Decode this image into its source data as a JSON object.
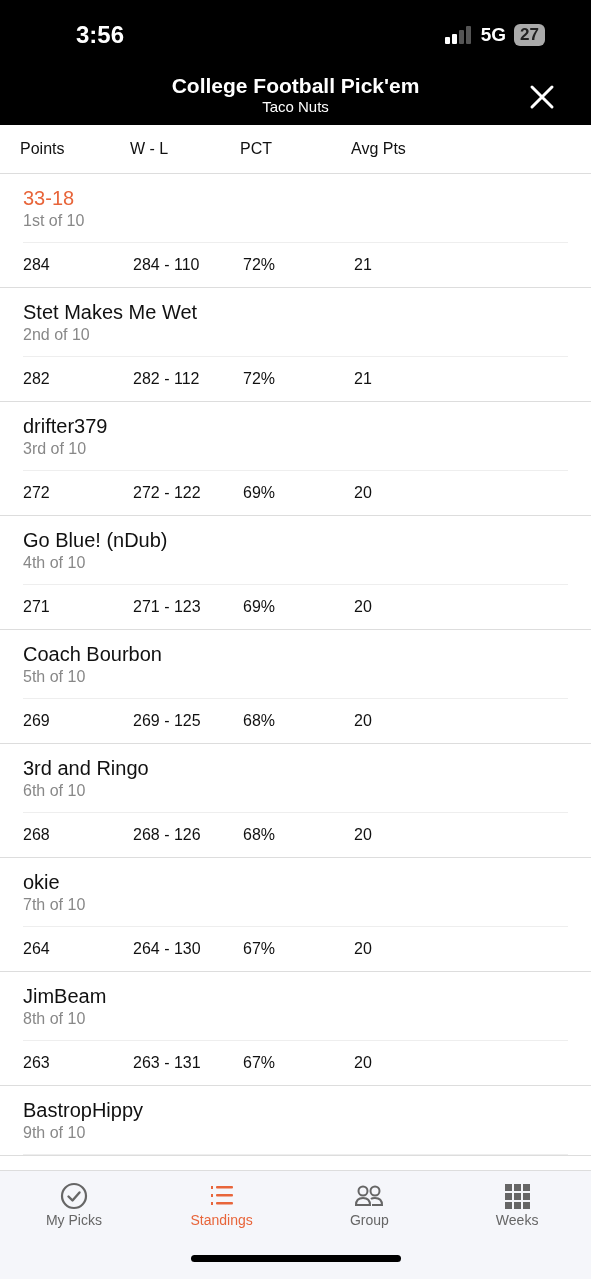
{
  "status_bar": {
    "time": "3:56",
    "network": "5G",
    "battery": "27"
  },
  "header": {
    "title": "College Football Pick'em",
    "subtitle": "Taco Nuts"
  },
  "columns": [
    "Points",
    "W - L",
    "PCT",
    "Avg Pts"
  ],
  "rows": [
    {
      "name": "33-18",
      "rank": "1st of 10",
      "highlighted": true,
      "stats": [
        "284",
        "284 - 110",
        "72%",
        "21"
      ]
    },
    {
      "name": "Stet Makes Me Wet",
      "rank": "2nd of 10",
      "highlighted": false,
      "stats": [
        "282",
        "282 - 112",
        "72%",
        "21"
      ]
    },
    {
      "name": "drifter379",
      "rank": "3rd of 10",
      "highlighted": false,
      "stats": [
        "272",
        "272 - 122",
        "69%",
        "20"
      ]
    },
    {
      "name": "Go Blue! (nDub)",
      "rank": "4th of 10",
      "highlighted": false,
      "stats": [
        "271",
        "271 - 123",
        "69%",
        "20"
      ]
    },
    {
      "name": "Coach Bourbon",
      "rank": "5th of 10",
      "highlighted": false,
      "stats": [
        "269",
        "269 - 125",
        "68%",
        "20"
      ]
    },
    {
      "name": "3rd and Ringo",
      "rank": "6th of 10",
      "highlighted": false,
      "stats": [
        "268",
        "268 - 126",
        "68%",
        "20"
      ]
    },
    {
      "name": "okie",
      "rank": "7th of 10",
      "highlighted": false,
      "stats": [
        "264",
        "264 - 130",
        "67%",
        "20"
      ]
    },
    {
      "name": "JimBeam",
      "rank": "8th of 10",
      "highlighted": false,
      "stats": [
        "263",
        "263 - 131",
        "67%",
        "20"
      ]
    },
    {
      "name": "BastropHippy",
      "rank": "9th of 10",
      "highlighted": false
    }
  ],
  "tabs": [
    {
      "kind": "picks",
      "label": "My Picks",
      "selected": false
    },
    {
      "kind": "standings",
      "label": "Standings",
      "selected": true
    },
    {
      "kind": "group",
      "label": "Group",
      "selected": false
    },
    {
      "kind": "weeks",
      "label": "Weeks",
      "selected": false
    }
  ]
}
